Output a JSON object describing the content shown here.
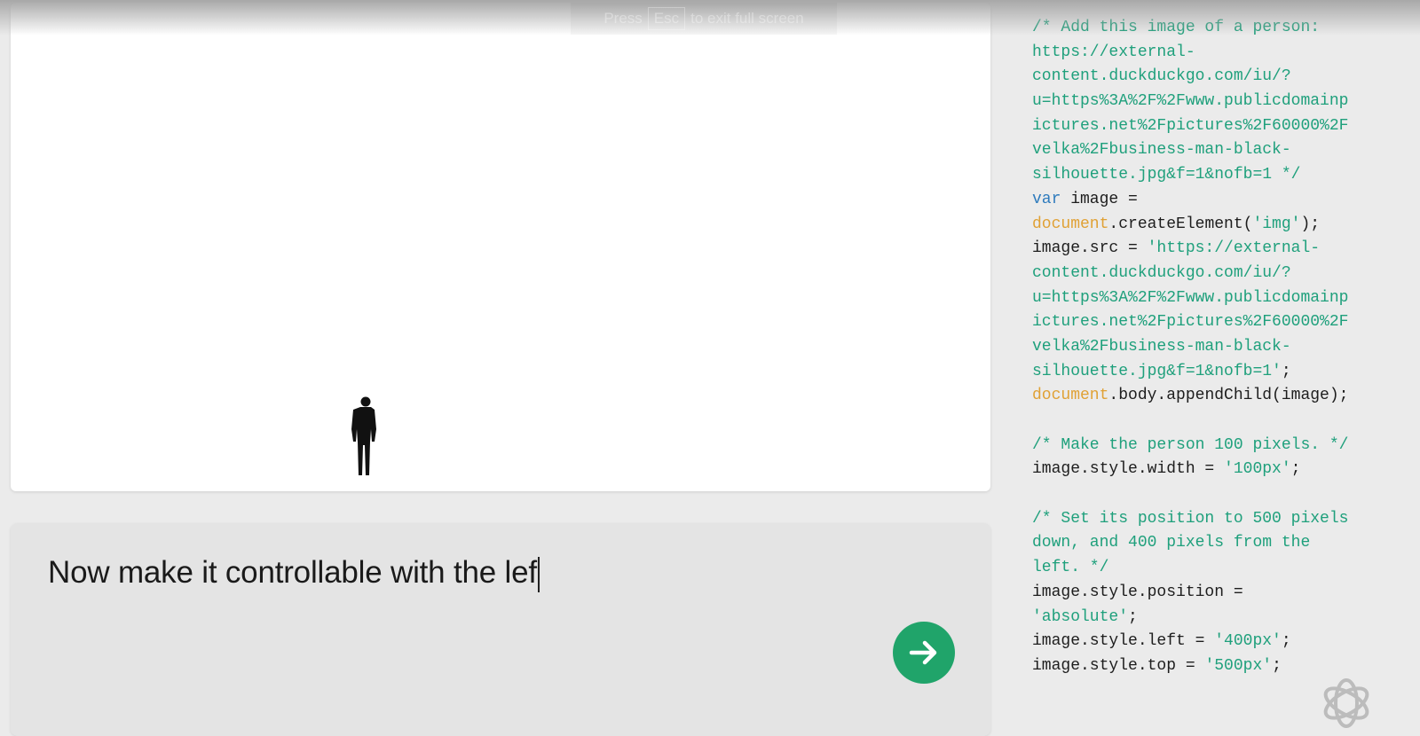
{
  "overlay": {
    "esc_hint_before": "Press",
    "esc_key": "Esc",
    "esc_hint_after": "to exit full screen"
  },
  "canvas": {
    "image_alt": "business man black silhouette"
  },
  "prompt": {
    "value": "Now make it controllable with the lef",
    "send_icon": "arrow-right-icon"
  },
  "colors": {
    "comment": "#1fa07c",
    "keyword": "#2e7bbd",
    "global": "#e0a135",
    "send_button": "#20a46a"
  },
  "code": [
    [
      [
        "/* Add this image of a person:",
        "comment"
      ]
    ],
    [
      [
        "https://external-",
        "comment"
      ]
    ],
    [
      [
        "content.duckduckgo.com/iu/?",
        "comment"
      ]
    ],
    [
      [
        "u=https%3A%2F%2Fwww.publicdomainp",
        "comment"
      ]
    ],
    [
      [
        "ictures.net%2Fpictures%2F60000%2F",
        "comment"
      ]
    ],
    [
      [
        "velka%2Fbusiness-man-black-",
        "comment"
      ]
    ],
    [
      [
        "silhouette.jpg&f=1&nofb=1 */",
        "comment"
      ]
    ],
    [
      [
        "var",
        "keyword"
      ],
      [
        " image =",
        "plain"
      ]
    ],
    [
      [
        "document",
        "global"
      ],
      [
        ".createElement(",
        "plain"
      ],
      [
        "'img'",
        "string"
      ],
      [
        ");",
        "plain"
      ]
    ],
    [
      [
        "image.src = ",
        "plain"
      ],
      [
        "'https://external-",
        "string"
      ]
    ],
    [
      [
        "content.duckduckgo.com/iu/?",
        "string"
      ]
    ],
    [
      [
        "u=https%3A%2F%2Fwww.publicdomainp",
        "string"
      ]
    ],
    [
      [
        "ictures.net%2Fpictures%2F60000%2F",
        "string"
      ]
    ],
    [
      [
        "velka%2Fbusiness-man-black-",
        "string"
      ]
    ],
    [
      [
        "silhouette.jpg&f=1&nofb=1'",
        "string"
      ],
      [
        ";",
        "plain"
      ]
    ],
    [
      [
        "document",
        "global"
      ],
      [
        ".body.appendChild(image);",
        "plain"
      ]
    ],
    [],
    [
      [
        "/* Make the person 100 pixels. */",
        "comment"
      ]
    ],
    [
      [
        "image.style.width = ",
        "plain"
      ],
      [
        "'100px'",
        "string"
      ],
      [
        ";",
        "plain"
      ]
    ],
    [],
    [
      [
        "/* Set its position to 500 pixels",
        "comment"
      ]
    ],
    [
      [
        "down, and 400 pixels from the",
        "comment"
      ]
    ],
    [
      [
        "left. */",
        "comment"
      ]
    ],
    [
      [
        "image.style.position =",
        "plain"
      ]
    ],
    [
      [
        "'absolute'",
        "string"
      ],
      [
        ";",
        "plain"
      ]
    ],
    [
      [
        "image.style.left = ",
        "plain"
      ],
      [
        "'400px'",
        "string"
      ],
      [
        ";",
        "plain"
      ]
    ],
    [
      [
        "image.style.top = ",
        "plain"
      ],
      [
        "'500px'",
        "string"
      ],
      [
        ";",
        "plain"
      ]
    ]
  ]
}
